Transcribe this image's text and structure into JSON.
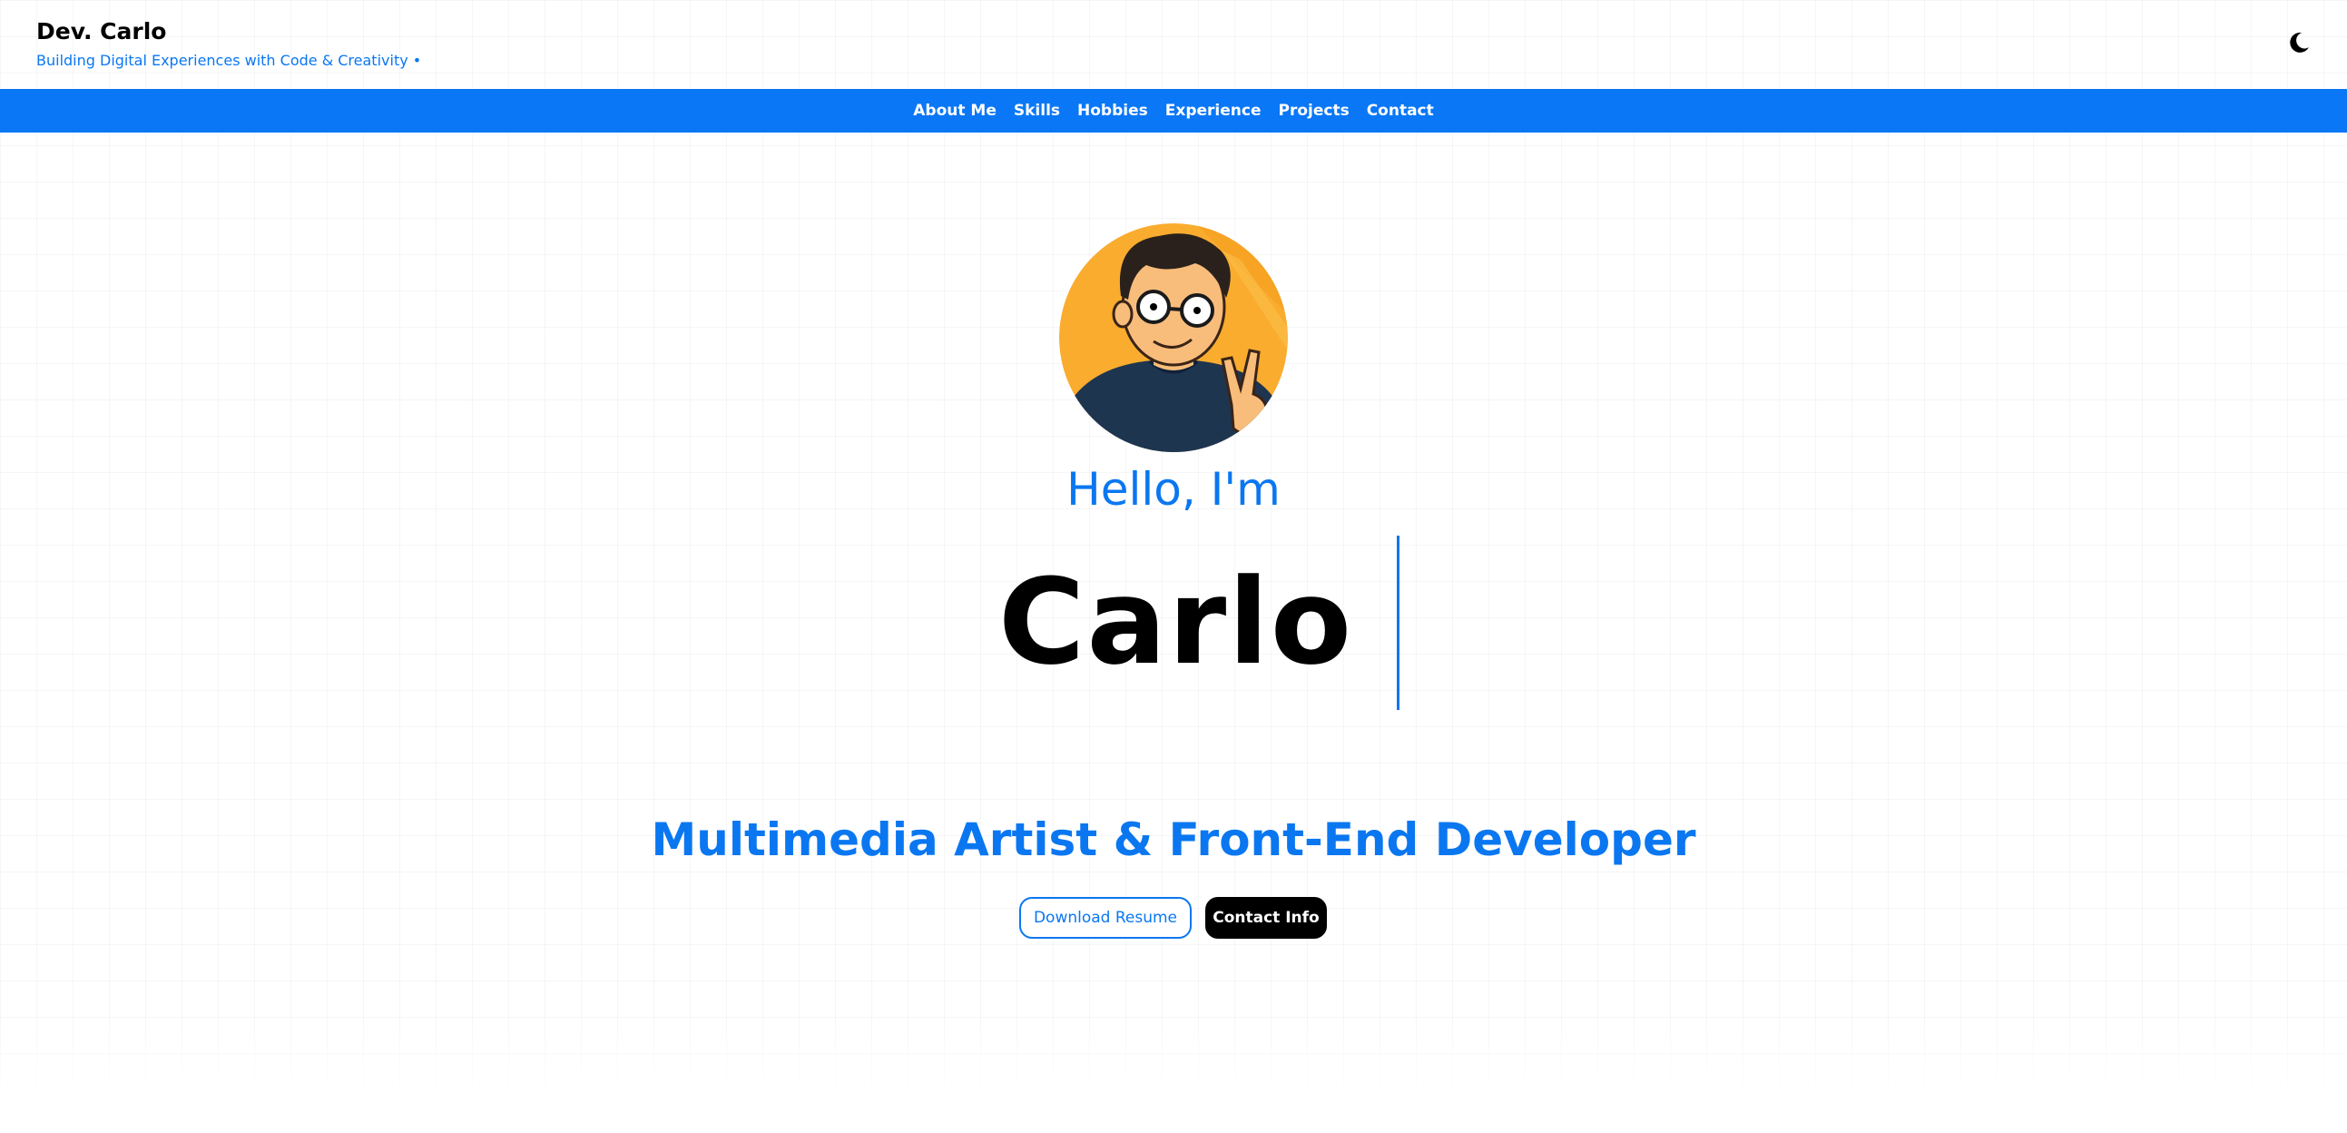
{
  "header": {
    "title": "Dev. Carlo",
    "tagline": "Building Digital Experiences with Code & Creativity •",
    "theme_toggle_icon": "moon-icon"
  },
  "nav": {
    "items": [
      {
        "label": "About Me"
      },
      {
        "label": "Skills"
      },
      {
        "label": "Hobbies"
      },
      {
        "label": "Experience"
      },
      {
        "label": "Projects"
      },
      {
        "label": "Contact"
      }
    ]
  },
  "hero": {
    "avatar_icon": "cartoon-avatar",
    "greeting": "Hello, I'm",
    "name": "Carlo",
    "role": "Multimedia Artist & Front-End Developer",
    "buttons": {
      "resume": "Download Resume",
      "contact": "Contact Info"
    }
  },
  "colors": {
    "accent": "#0a77f7",
    "text": "#000000",
    "avatar_bg": "#f9ac2e",
    "shirt": "#1e3550"
  }
}
